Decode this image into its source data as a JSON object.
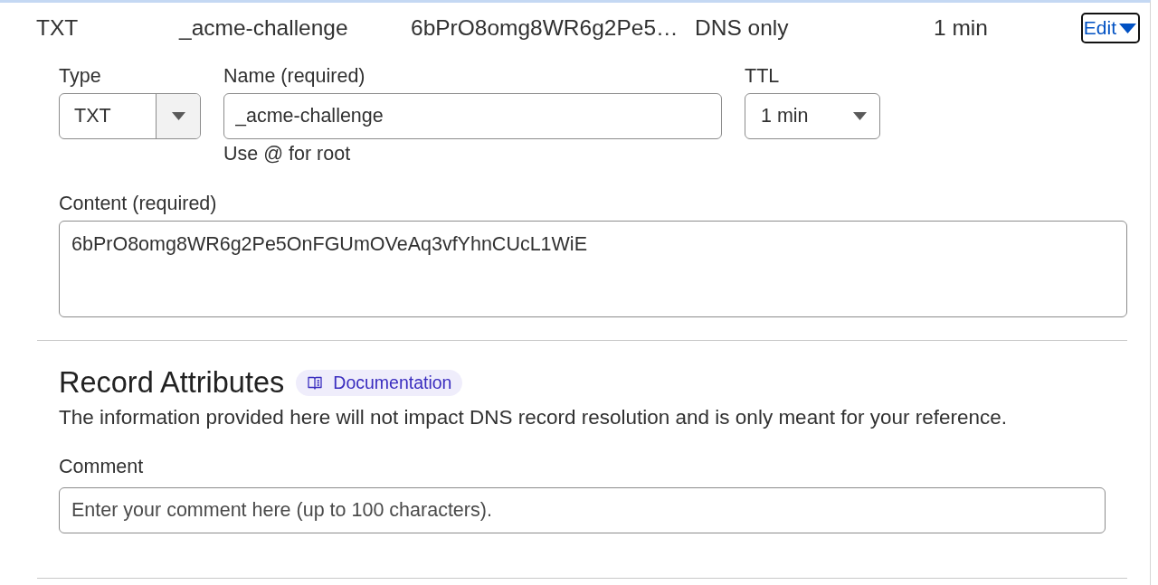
{
  "record_row": {
    "type": "TXT",
    "name": "_acme-challenge",
    "content": "6bPrO8omg8WR6g2Pe5…",
    "proxy_status": "DNS only",
    "ttl": "1 min",
    "edit_button": {
      "label": "Edit",
      "focused": true
    }
  },
  "form": {
    "type_field": {
      "label": "Type",
      "value": "TXT"
    },
    "name_field": {
      "label": "Name (required)",
      "value": "_acme-challenge",
      "hint": "Use @ for root"
    },
    "ttl_field": {
      "label": "TTL",
      "value": "1 min"
    },
    "content_field": {
      "label": "Content (required)",
      "value": "6bPrO8omg8WR6g2Pe5OnFGUmOVeAq3vfYhnCUcL1WiE"
    }
  },
  "record_attributes": {
    "title": "Record Attributes",
    "documentation_link": "Documentation",
    "description": "The information provided here will not impact DNS record resolution and is only meant for your reference.",
    "comment_field": {
      "label": "Comment",
      "placeholder": "Enter your comment here (up to 100 characters)."
    }
  }
}
